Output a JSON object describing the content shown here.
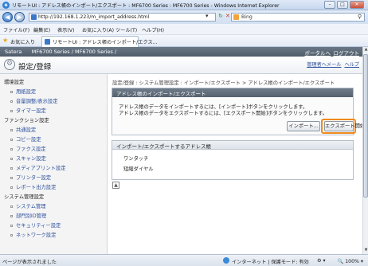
{
  "window": {
    "title": "リモートUI : アドレス帳のインポート/エクスポート : MF6700 Series : MF6700 Series - Windows Internet Explorer",
    "minimize": "–",
    "maximize": "□",
    "close": "✕"
  },
  "address_bar": {
    "back_icon": "◀",
    "forward_icon": "▶",
    "url": "http://192.168.1.223/m_import_address.html",
    "dropdown": "▾",
    "refresh": "↻",
    "stop": "✕",
    "search_provider": "Bing",
    "search_icon": "⚲"
  },
  "menu": [
    "ファイル(F)",
    "編集(E)",
    "表示(V)",
    "お気に入り(A)",
    "ツール(T)",
    "ヘルプ(H)"
  ],
  "favorites": {
    "label": "お気に入り",
    "tab_title": "リモートUI : アドレス帳のインポート/エクス..."
  },
  "header": {
    "brand": "Satera",
    "product": "MF6700 Series / MF6700 Series /",
    "portal_link": "ポータルへ",
    "logout_link": "ログアウト",
    "page_title": "設定/登録",
    "mail_link": "管理者へメール",
    "help_link": "ヘルプ"
  },
  "sidebar": {
    "sections": [
      {
        "label": "環境設定",
        "items": [
          "用紙設定",
          "音量調整/表示設定",
          "タイマー設定"
        ]
      },
      {
        "label": "ファンクション設定",
        "items": [
          "共通設定",
          "コピー設定",
          "ファクス設定",
          "スキャン設定",
          "メディアプリント設定",
          "プリンター設定",
          "レポート出力設定"
        ]
      },
      {
        "label": "システム管理設定",
        "items": [
          "システム管理",
          "部門別ID管理",
          "セキュリティー設定",
          "ネットワーク設定"
        ]
      }
    ]
  },
  "main": {
    "breadcrumb": "設定/登録 : システム管理設定 : インポート/エクスポート > アドレス帳のインポート/エクスポート",
    "import_panel": {
      "title": "アドレス帳のインポート/エクスポート",
      "desc_import": "アドレス帳のデータをインポートするには、[インポート]ボタンをクリックします。",
      "desc_export": "アドレス帳のデータをエクスポートするには、[エクスポート開始]ボタンをクリックします。",
      "import_button": "インポート...",
      "export_button": "エクスポート開始"
    },
    "book_panel": {
      "title": "インポート/エクスポートするアドレス帳",
      "items": [
        "ワンタッチ",
        "短縮ダイヤル"
      ]
    },
    "to_top": "▲"
  },
  "status_bar": {
    "text": "ページが表示されました",
    "zone": "インターネット | 保護モード: 有効",
    "extra": "⚙ ▾",
    "zoom": "🔍 100% ▾"
  },
  "colors": {
    "header_bar": "#55616e",
    "accent_outline": "#f08a1c",
    "link": "#2a4f9c"
  }
}
